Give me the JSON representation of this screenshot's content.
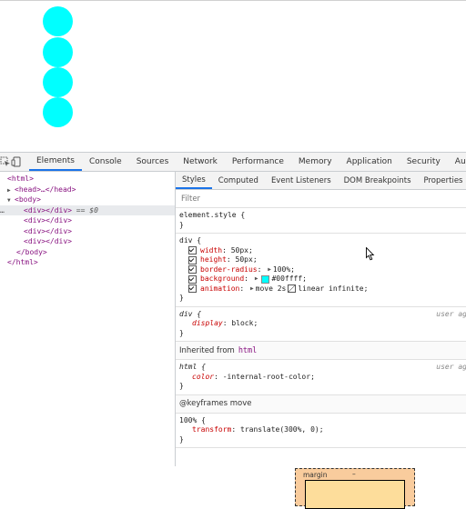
{
  "preview": {
    "circle_color": "#00ffff",
    "circle_count": 4
  },
  "toolbar": {
    "inspect_icon": "inspect-cursor-icon",
    "device_icon": "device-toggle-icon",
    "tabs": [
      "Elements",
      "Console",
      "Sources",
      "Network",
      "Performance",
      "Memory",
      "Application",
      "Security",
      "Audits"
    ],
    "active_tab": "Elements"
  },
  "dom": {
    "lines": [
      {
        "text": "<html>"
      },
      {
        "text": "<head>…</head>"
      },
      {
        "text": "<body>"
      },
      {
        "text": "<div></div>",
        "suffix": " == $0",
        "dots": "…"
      },
      {
        "text": "<div></div>"
      },
      {
        "text": "<div></div>"
      },
      {
        "text": "<div></div>"
      },
      {
        "text": "</body>"
      },
      {
        "text": "</html>"
      }
    ]
  },
  "styles": {
    "subtabs": [
      "Styles",
      "Computed",
      "Event Listeners",
      "DOM Breakpoints",
      "Properties",
      "Ac"
    ],
    "active_subtab": "Styles",
    "filter_placeholder": "Filter",
    "element_style": {
      "selector": "element.style {",
      "close": "}"
    },
    "div_rule": {
      "selector": "div {",
      "close": "}",
      "decls": [
        {
          "name": "width",
          "value": "50px;"
        },
        {
          "name": "height",
          "value": "50px;"
        },
        {
          "name": "border-radius",
          "value": "100%;"
        },
        {
          "name": "background",
          "value": "#00ffff;"
        },
        {
          "name": "animation",
          "value_a": "move 2s",
          "value_b": "linear infinite;"
        }
      ]
    },
    "ua_div_rule": {
      "selector": "div {",
      "origin": "user ag",
      "decl_name": "display",
      "decl_value": "block;",
      "close": "}"
    },
    "inherited_label": "Inherited from",
    "inherited_tag": "html",
    "html_rule": {
      "selector": "html {",
      "origin": "user ag",
      "decl_name": "color",
      "decl_value": "-internal-root-color;",
      "close": "}"
    },
    "keyframes_label": "@keyframes move",
    "keyframe_rule": {
      "selector": "100% {",
      "decl_name": "transform",
      "decl_value": "translate(300%, 0);",
      "close": "}"
    }
  },
  "box_model": {
    "label": "margin",
    "value": "–"
  }
}
